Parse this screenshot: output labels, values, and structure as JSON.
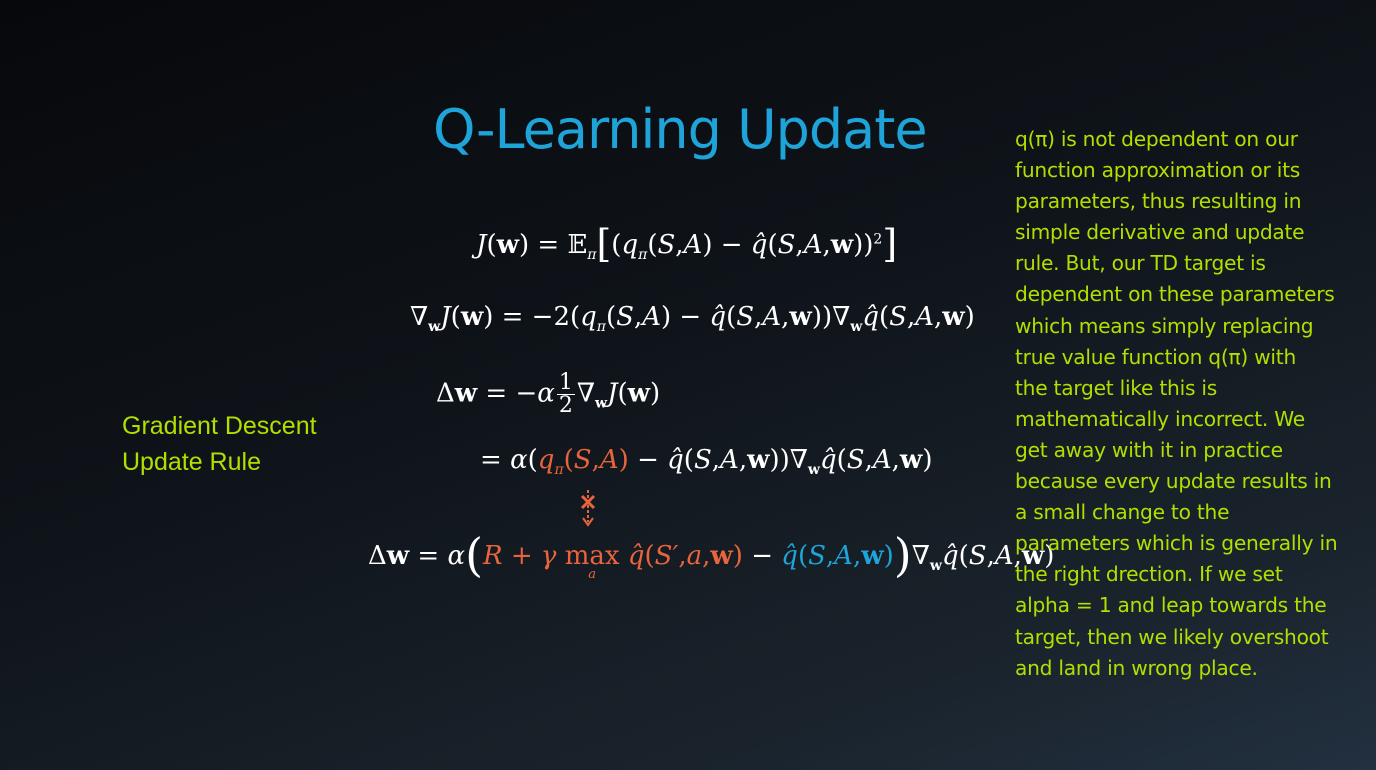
{
  "slide": {
    "title": "Q-Learning Update",
    "side_label_lines": [
      "Gradient Descent",
      "Update Rule"
    ],
    "note_lines": [
      "q(π) is not dependent on our",
      "function approximation or its",
      "parameters, thus resulting in",
      "simple derivative and update",
      "rule. But, our TD target is",
      "dependent on these parameters",
      "which means simply replacing",
      "true value function q(π) with",
      "the target like this is",
      "mathematically incorrect. We",
      "get away with it in practice",
      "because every update results in",
      "a small change to the",
      "parameters which is generally in",
      "the right drection. If we set",
      "alpha = 1 and leap towards the",
      "target, then we likely overshoot",
      "and land in wrong place."
    ]
  },
  "colors": {
    "title": "#1ea4d8",
    "annotation": "#b0e000",
    "target_term": "#e8643c",
    "estimate_term": "#1ea4d8",
    "equation": "#ffffff"
  }
}
